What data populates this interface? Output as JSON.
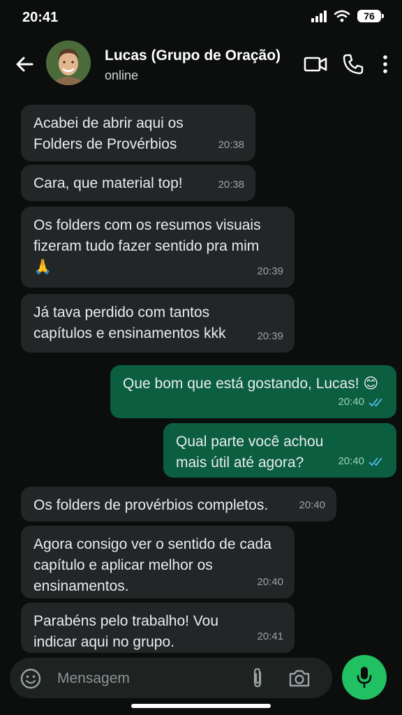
{
  "status_bar": {
    "time": "20:41",
    "battery": "76"
  },
  "header": {
    "contact_name": "Lucas (Grupo de Oração)",
    "contact_status": "online"
  },
  "messages": [
    {
      "direction": "in",
      "text": "Acabei de abrir aqui os\nFolders de Provérbios",
      "time": "20:38"
    },
    {
      "direction": "in",
      "text": "Cara, que material top!",
      "time": "20:38"
    },
    {
      "direction": "in",
      "text": "Os folders com os resumos visuais\nfizeram tudo fazer sentido pra mim\n🙏",
      "time": "20:39"
    },
    {
      "direction": "in",
      "text": "Já tava perdido com tantos\ncapítulos e ensinamentos kkk",
      "time": "20:39"
    },
    {
      "direction": "out",
      "text": "Que bom que está gostando, Lucas! 😊",
      "time": "20:40",
      "status": "read"
    },
    {
      "direction": "out",
      "text": "Qual parte você achou\nmais útil até agora?",
      "time": "20:40",
      "status": "read"
    },
    {
      "direction": "in",
      "text": "Os folders de provérbios completos.",
      "time": "20:40"
    },
    {
      "direction": "in",
      "text": "Agora consigo ver o sentido de cada\ncapítulo e aplicar melhor os\nensinamentos.",
      "time": "20:40"
    },
    {
      "direction": "in",
      "text": "Parabéns pelo trabalho! Vou\nindicar aqui no grupo.",
      "time": "20:41"
    }
  ],
  "composer": {
    "placeholder": "Mensagem"
  },
  "icons": {
    "back": "back-arrow-icon",
    "video": "video-call-icon",
    "phone": "phone-icon",
    "menu": "more-options-icon",
    "emoji": "emoji-icon",
    "attach": "attach-icon",
    "camera": "camera-icon",
    "mic": "mic-icon",
    "read_receipt": "double-check-icon"
  },
  "colors": {
    "background": "#0b0e0d",
    "incoming_bubble": "#232626",
    "outgoing_bubble": "#0b5e3f",
    "read_tick": "#53bdeb",
    "mic_button": "#21c063"
  }
}
